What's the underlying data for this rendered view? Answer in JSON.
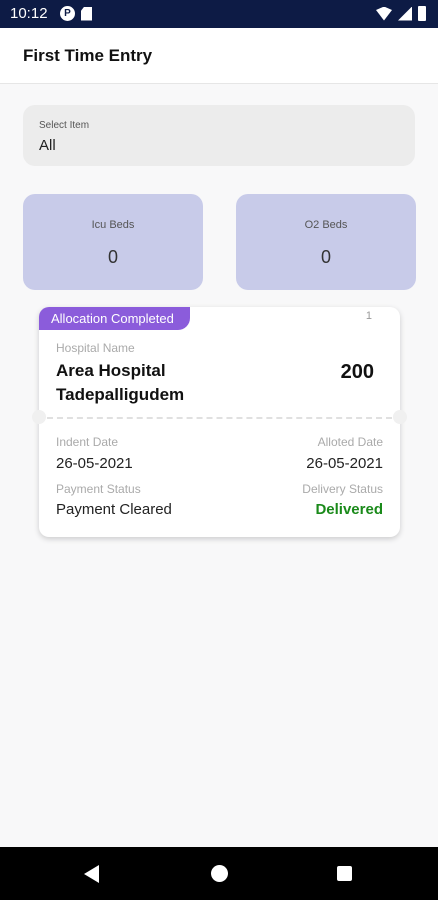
{
  "status_bar": {
    "time": "10:12",
    "icons": [
      "notification-icon",
      "sd-card-icon",
      "wifi-icon",
      "signal-icon",
      "battery-icon"
    ]
  },
  "app_bar": {
    "title": "First Time Entry"
  },
  "select_item": {
    "label": "Select Item",
    "value": "All"
  },
  "stats": [
    {
      "label": "Icu Beds",
      "value": "0"
    },
    {
      "label": "O2 Beds",
      "value": "0"
    }
  ],
  "card": {
    "badge": "Allocation Completed",
    "index": "1",
    "hospital_label": "Hospital Name",
    "hospital_name": "Area Hospital Tadepalligudem",
    "amount": "200",
    "indent_date_label": "Indent Date",
    "indent_date": "26-05-2021",
    "alloted_date_label": "Alloted Date",
    "alloted_date": "26-05-2021",
    "payment_status_label": "Payment Status",
    "payment_status": "Payment Cleared",
    "delivery_status_label": "Delivery Status",
    "delivery_status": "Delivered"
  },
  "colors": {
    "status_bar": "#0d1b45",
    "stat_card": "#c8cbe9",
    "badge": "#8b5cdb",
    "delivered": "#1a8a1a"
  },
  "nav_bar": {
    "icons": [
      "back-icon",
      "home-icon",
      "recents-icon"
    ]
  }
}
